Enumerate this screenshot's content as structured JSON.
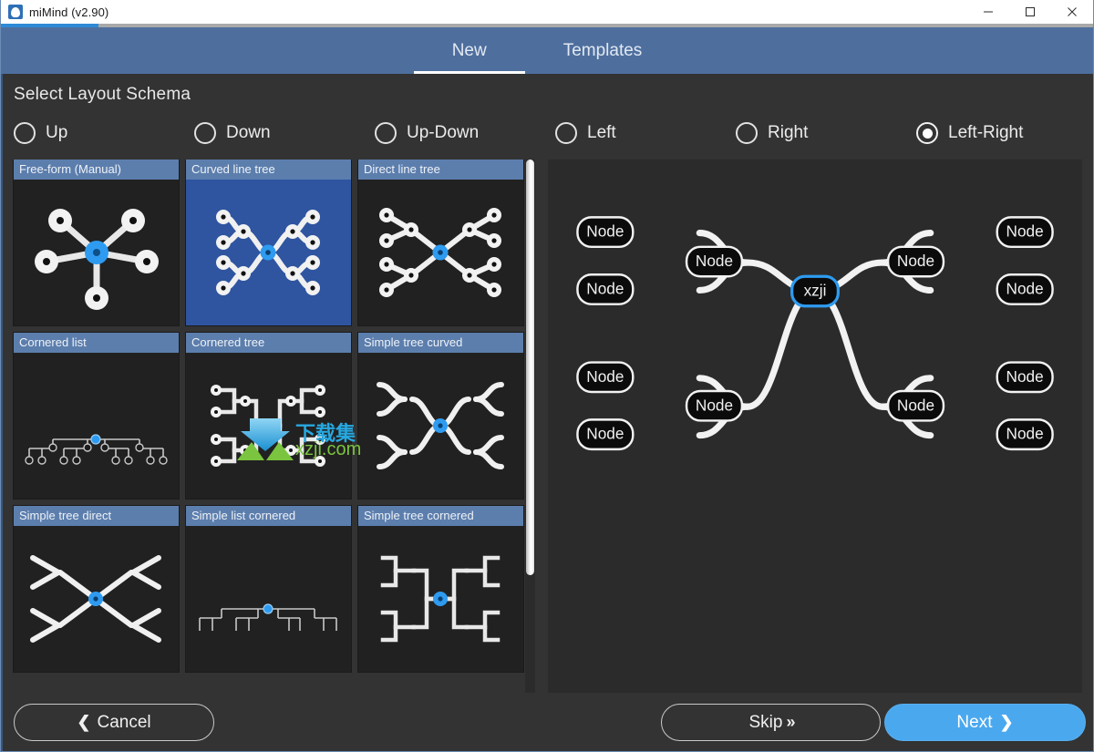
{
  "window": {
    "title": "miMind (v2.90)",
    "icon": "app-icon",
    "controls": [
      {
        "name": "minimize",
        "glyph": "minimize-icon"
      },
      {
        "name": "maximize",
        "glyph": "maximize-icon"
      },
      {
        "name": "close",
        "glyph": "close-icon"
      }
    ]
  },
  "progress": {
    "percent": 9
  },
  "tabs": [
    {
      "label": "New",
      "active": true
    },
    {
      "label": "Templates",
      "active": false
    }
  ],
  "section": {
    "title": "Select Layout Schema"
  },
  "layout_options": [
    {
      "label": "Up",
      "selected": false
    },
    {
      "label": "Down",
      "selected": false
    },
    {
      "label": "Up-Down",
      "selected": false
    },
    {
      "label": "Left",
      "selected": false
    },
    {
      "label": "Right",
      "selected": false
    },
    {
      "label": "Left-Right",
      "selected": true
    }
  ],
  "schemas": [
    {
      "label": "Free-form (Manual)",
      "selected": false,
      "art": "freeform"
    },
    {
      "label": "Curved line tree",
      "selected": true,
      "art": "curved-tree"
    },
    {
      "label": "Direct line tree",
      "selected": false,
      "art": "direct-tree"
    },
    {
      "label": "Cornered list",
      "selected": false,
      "art": "cornered-list"
    },
    {
      "label": "Cornered tree",
      "selected": false,
      "art": "cornered-tree"
    },
    {
      "label": "Simple tree curved",
      "selected": false,
      "art": "simple-tree-curved"
    },
    {
      "label": "Simple tree direct",
      "selected": false,
      "art": "simple-tree-direct"
    },
    {
      "label": "Simple list cornered",
      "selected": false,
      "art": "simple-list-cornered"
    },
    {
      "label": "Simple tree cornered",
      "selected": false,
      "art": "simple-tree-cornered"
    }
  ],
  "scrollbar": {
    "thumb_percent": 78
  },
  "preview": {
    "root_label": "xzji",
    "node_label": "Node",
    "nodes": [
      {
        "label": "Node",
        "side": "left",
        "level": 2
      },
      {
        "label": "Node",
        "side": "left",
        "level": 2
      },
      {
        "label": "Node",
        "side": "left",
        "level": 1
      },
      {
        "label": "Node",
        "side": "left",
        "level": 2
      },
      {
        "label": "Node",
        "side": "left",
        "level": 2
      },
      {
        "label": "Node",
        "side": "left",
        "level": 1
      },
      {
        "label": "Node",
        "side": "right",
        "level": 1
      },
      {
        "label": "Node",
        "side": "right",
        "level": 2
      },
      {
        "label": "Node",
        "side": "right",
        "level": 2
      },
      {
        "label": "Node",
        "side": "right",
        "level": 1
      },
      {
        "label": "Node",
        "side": "right",
        "level": 2
      },
      {
        "label": "Node",
        "side": "right",
        "level": 2
      }
    ]
  },
  "footer": {
    "cancel": {
      "label": "Cancel",
      "glyph": "❮"
    },
    "skip": {
      "label": "Skip",
      "glyph": "»"
    },
    "next": {
      "label": "Next",
      "glyph": "❯"
    }
  },
  "watermark": {
    "cn_text": "下载集",
    "url_text": "xzji.com"
  },
  "colors": {
    "accent": "#2e8ad6",
    "tabbar": "#4e6f9e",
    "tile_caption": "#5c7ead",
    "tile_selected": "#2f55a0",
    "next_button": "#4aa8ef",
    "node_border": "#ffffff",
    "root_border": "#2e9bf0",
    "watermark_cn": "#27a8e0",
    "watermark_url": "#7ac43f"
  }
}
